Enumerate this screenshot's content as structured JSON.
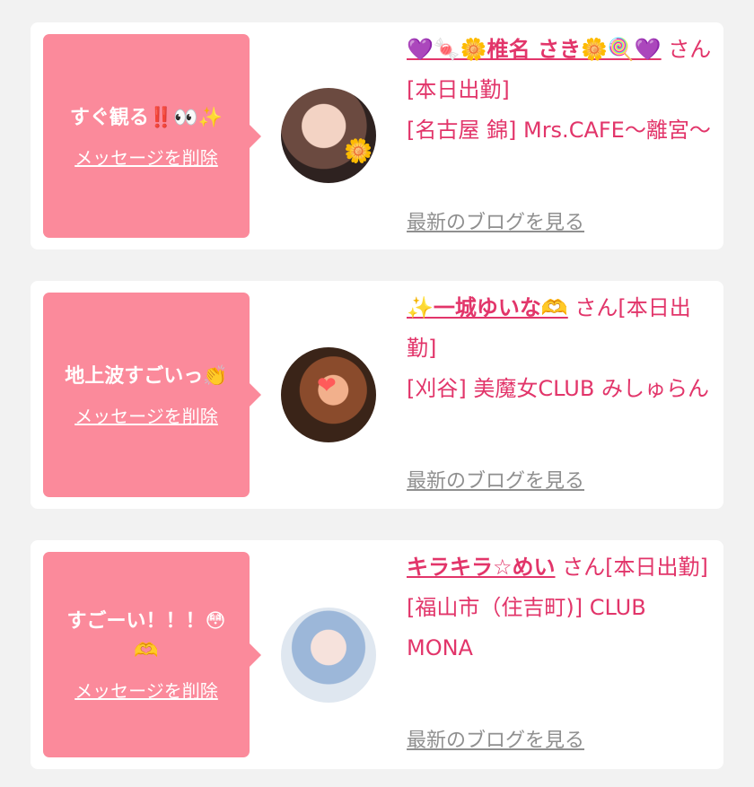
{
  "cards": [
    {
      "message": "すぐ観る‼️👀✨",
      "delete_label": "メッセージを削除",
      "name": "💜🍬🌼椎名 さき🌼🍭💜",
      "suffix": "さん[本日出勤]",
      "shop": "[名古屋 錦] Mrs.CAFE〜離宮〜",
      "blog_label": "最新のブログを見る",
      "avatar_icon": "sparkle-flower",
      "avatar_mark": "🌼"
    },
    {
      "message": "地上波すごいっ👏",
      "delete_label": "メッセージを削除",
      "name": "✨一城ゆいな🫶",
      "suffix": "さん[本日出勤]",
      "shop": "[刈谷] 美魔女CLUB みしゅらん",
      "blog_label": "最新のブログを見る",
      "avatar_icon": "heart-sticker",
      "avatar_mark": "❤"
    },
    {
      "message": "すごーい！！！😳🫶",
      "delete_label": "メッセージを削除",
      "name": "キラキラ☆めい",
      "suffix": "さん[本日出勤]",
      "shop": "[福山市（住吉町)] CLUB MONA",
      "blog_label": "最新のブログを見る",
      "avatar_icon": "",
      "avatar_mark": ""
    }
  ]
}
